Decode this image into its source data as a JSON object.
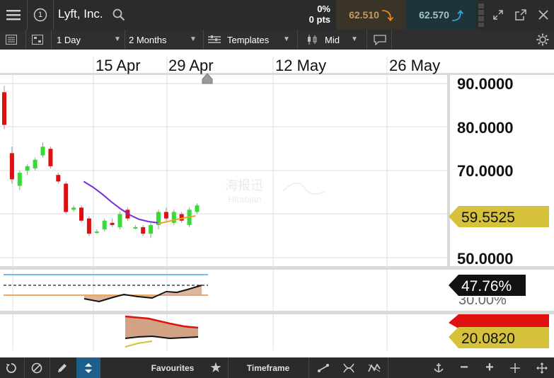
{
  "header": {
    "alert_count": "1",
    "title": "Lyft, Inc.",
    "change_percent": "0%",
    "change_pts": "0 pts",
    "sell_price": "62.510",
    "buy_price": "62.570"
  },
  "toolbar": {
    "interval": "1 Day",
    "range": "2 Months",
    "templates": "Templates",
    "price_type": "Mid"
  },
  "time_axis": {
    "labels": [
      "15 Apr",
      "29 Apr",
      "12 May",
      "26 May"
    ]
  },
  "price_axis": {
    "labels": [
      "90.0000",
      "80.0000",
      "70.0000",
      "50.0000"
    ],
    "current_price_label": "59.5525"
  },
  "oscillator_panel": {
    "value_label": "47.76%",
    "partial_label": "30.00%"
  },
  "lower_panel": {
    "value_label": "20.0820"
  },
  "watermark": {
    "text_cn": "海报迅",
    "text_en": "Hitabian"
  },
  "bottom": {
    "favourites": "Favourites",
    "timeframe": "Timeframe"
  },
  "colors": {
    "bull": "#33dd33",
    "bear": "#e01010",
    "ma_purple": "#7a2be0",
    "ma_orange": "#f0a020",
    "price_tag": "#d6c23a",
    "sell_accent": "#f08a17",
    "buy_accent": "#35a7d6"
  },
  "chart_data": {
    "type": "candlestick",
    "x_labels": [
      "15 Apr",
      "29 Apr",
      "12 May",
      "26 May"
    ],
    "ylim": [
      50,
      90
    ],
    "y_ticks": [
      90,
      80,
      70,
      50
    ],
    "last_price": 59.5525,
    "series": [
      {
        "o": 88.0,
        "h": 89.5,
        "l": 79.5,
        "c": 80.5
      },
      {
        "o": 74.0,
        "h": 75.5,
        "l": 67.0,
        "c": 68.0
      },
      {
        "o": 66.5,
        "h": 70.0,
        "l": 65.5,
        "c": 69.5
      },
      {
        "o": 70.0,
        "h": 71.5,
        "l": 69.0,
        "c": 71.0
      },
      {
        "o": 70.5,
        "h": 73.0,
        "l": 70.0,
        "c": 72.5
      },
      {
        "o": 73.5,
        "h": 76.5,
        "l": 73.0,
        "c": 75.5
      },
      {
        "o": 75.0,
        "h": 75.5,
        "l": 70.5,
        "c": 71.0
      },
      {
        "o": 69.0,
        "h": 69.5,
        "l": 67.0,
        "c": 67.5
      },
      {
        "o": 67.0,
        "h": 67.5,
        "l": 60.0,
        "c": 60.5
      },
      {
        "o": 61.0,
        "h": 62.0,
        "l": 60.5,
        "c": 61.5
      },
      {
        "o": 61.5,
        "h": 62.0,
        "l": 58.0,
        "c": 58.5
      },
      {
        "o": 59.0,
        "h": 59.5,
        "l": 55.0,
        "c": 55.5
      },
      {
        "o": 56.0,
        "h": 56.5,
        "l": 55.5,
        "c": 56.0
      },
      {
        "o": 56.5,
        "h": 59.0,
        "l": 56.0,
        "c": 58.5
      },
      {
        "o": 58.0,
        "h": 59.0,
        "l": 57.0,
        "c": 57.5
      },
      {
        "o": 57.0,
        "h": 60.5,
        "l": 56.5,
        "c": 60.0
      },
      {
        "o": 61.0,
        "h": 61.5,
        "l": 58.5,
        "c": 59.0
      },
      {
        "o": 57.0,
        "h": 57.5,
        "l": 56.5,
        "c": 57.0
      },
      {
        "o": 57.0,
        "h": 57.5,
        "l": 55.0,
        "c": 55.5
      },
      {
        "o": 55.5,
        "h": 58.0,
        "l": 54.5,
        "c": 57.5
      },
      {
        "o": 57.5,
        "h": 61.0,
        "l": 56.5,
        "c": 60.5
      },
      {
        "o": 60.5,
        "h": 61.5,
        "l": 58.5,
        "c": 59.0
      },
      {
        "o": 58.0,
        "h": 61.0,
        "l": 57.5,
        "c": 60.5
      },
      {
        "o": 60.0,
        "h": 60.5,
        "l": 58.0,
        "c": 58.5
      },
      {
        "o": 57.5,
        "h": 61.5,
        "l": 57.0,
        "c": 61.0
      },
      {
        "o": 60.5,
        "h": 62.5,
        "l": 60.0,
        "c": 62.0
      }
    ],
    "ma_purple": [
      67.5,
      66.2,
      64.6,
      62.8,
      61.2,
      59.8,
      58.8,
      58.3,
      58.0
    ],
    "ma_orange": [
      57.8,
      58.3,
      58.8,
      59.2,
      59.6
    ]
  }
}
